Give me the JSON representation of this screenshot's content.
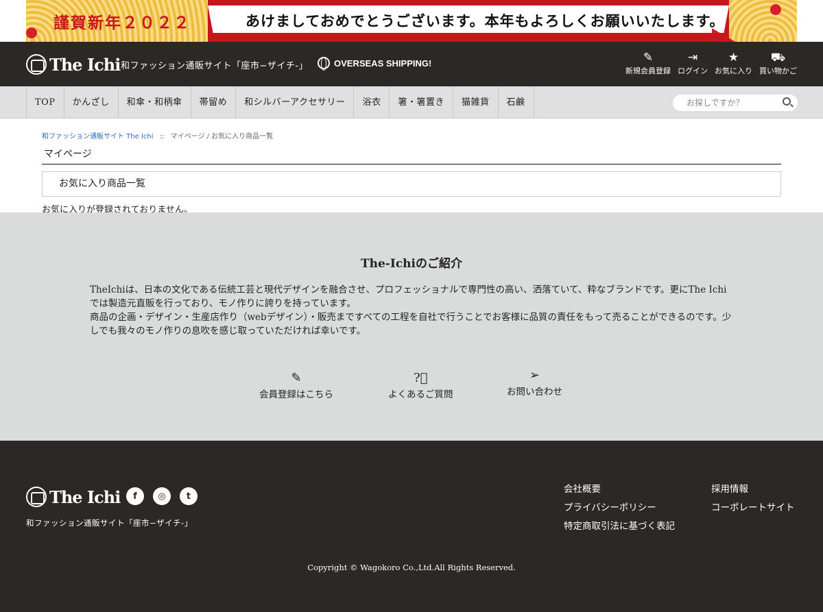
{
  "banner": {
    "title": "謹賀新年２０２２",
    "message": "あけましておめでとうございます。本年もよろしくお願いいたします。"
  },
  "header": {
    "logo_text": "The Ichi",
    "tagline": "和ファッション通販サイト「座市−ザイチ-」",
    "overseas": "OVERSEAS SHIPPING!",
    "nav": [
      {
        "label": "新規会員登録",
        "icon": "register-icon"
      },
      {
        "label": "ログイン",
        "icon": "login-icon"
      },
      {
        "label": "お気に入り",
        "icon": "star-icon"
      },
      {
        "label": "買い物かご",
        "icon": "cart-icon"
      }
    ]
  },
  "gnav": {
    "items": [
      "TOP",
      "かんざし",
      "和傘・和柄傘",
      "帯留め",
      "和シルバーアクセサリー",
      "浴衣",
      "箸・箸置き",
      "猫雑貨",
      "石鹸"
    ],
    "search_placeholder": "お探しですか？"
  },
  "breadcrumb": {
    "home": "和ファッション通販サイト The Ichi",
    "sep": "::",
    "current": "マイページ / お気に入り商品一覧"
  },
  "main": {
    "title": "マイページ",
    "section": "お気に入り商品一覧",
    "empty": "お気に入りが登録されておりません。"
  },
  "intro": {
    "title": "The-Ichiのご紹介",
    "paragraph1": "TheIchiは、日本の文化である伝統工芸と現代デザインを融合させ、プロフェッショナルで専門性の高い、洒落ていて、粋なブランドです。更にThe Ichiでは製造元直販を行っており、モノ作りに誇りを持っています。",
    "paragraph2": "商品の企画・デザイン・生産店作り（webデザイン）・販売まですべての工程を自社で行うことでお客様に品質の責任をもって売ることができるのです。少しでも我々のモノ作りの息吹を感じ取っていただければ幸いです。",
    "links": [
      {
        "label": "会員登録はこちら",
        "icon": "register-icon"
      },
      {
        "label": "よくあるご質問",
        "icon": "question-icon"
      },
      {
        "label": "お問い合わせ",
        "icon": "send-icon"
      }
    ]
  },
  "footer": {
    "logo_text": "The Ichi",
    "tagline": "和ファッション通販サイト「座市−ザイチ-」",
    "social": [
      {
        "name": "facebook-icon",
        "glyph": "f"
      },
      {
        "name": "instagram-icon",
        "glyph": "◎"
      },
      {
        "name": "twitter-icon",
        "glyph": "t"
      }
    ],
    "col1": [
      "会社概要",
      "プライバシーポリシー",
      "特定商取引法に基づく表記"
    ],
    "col2": [
      "採用情報",
      "コーポレートサイト"
    ],
    "copyright": "Copyright ©  Wagokoro Co.,Ltd.All Rights Reserved."
  }
}
